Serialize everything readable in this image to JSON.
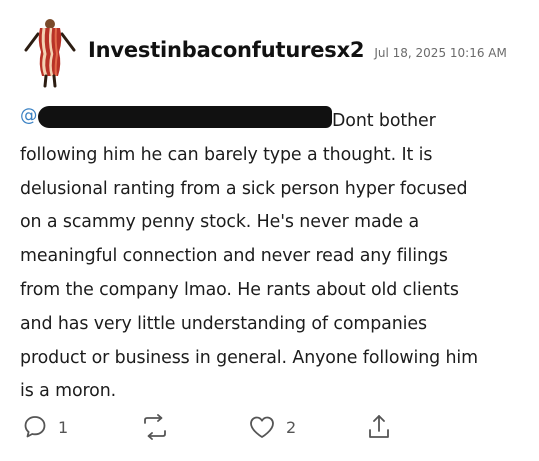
{
  "author": {
    "username": "Investinbaconfuturesx2",
    "avatar_icon": "bacon-costume-avatar"
  },
  "post": {
    "timestamp": "Jul 18, 2025 10:16 AM",
    "mention_visible": "@",
    "mention_redacted": true,
    "lines": [
      "Dont bother",
      "following him he can barely type a thought. It is",
      "delusional ranting from a sick person hyper focused",
      "on a scammy penny stock.  He's never made a",
      "meaningful connection and never read any filings",
      "from the company lmao. He rants about old clients",
      "and has very little understanding of companies",
      "product or business in general. Anyone following him",
      "is a moron."
    ]
  },
  "actions": {
    "reply_icon": "comment-icon",
    "reply_count": "1",
    "repost_icon": "repost-icon",
    "like_icon": "heart-icon",
    "like_count": "2",
    "share_icon": "share-icon"
  },
  "colors": {
    "mention": "#3b82c4",
    "text": "#1c1c1c",
    "meta": "#6b6b6b",
    "icon": "#555555",
    "bacon_red": "#c0392b",
    "bacon_fat": "#f3d2b3"
  }
}
